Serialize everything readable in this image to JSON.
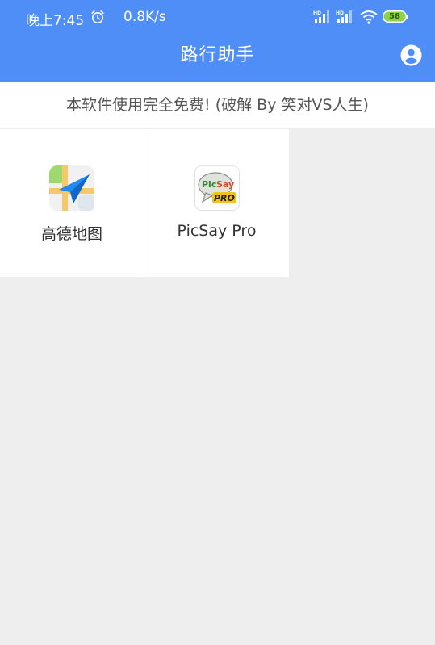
{
  "status_bar": {
    "time": "晚上7:45",
    "net_speed": "0.8K/s",
    "battery_level": "58",
    "icons": [
      "alarm-icon",
      "signal-hd-icon",
      "signal-hd-icon",
      "wifi-icon",
      "battery-icon"
    ]
  },
  "app_bar": {
    "title": "路行助手",
    "account_icon": "account-circle-icon"
  },
  "notice": {
    "text": "本软件使用完全免费! (破解 By 笑对VS人生)"
  },
  "apps": [
    {
      "label": "高德地图",
      "icon": "amap-icon"
    },
    {
      "label": "PicSay Pro",
      "icon": "picsay-pro-icon"
    }
  ],
  "colors": {
    "primary": "#4f8ef7",
    "background": "#eeeeee",
    "tile": "#ffffff",
    "battery_fill": "#8bd14a"
  }
}
